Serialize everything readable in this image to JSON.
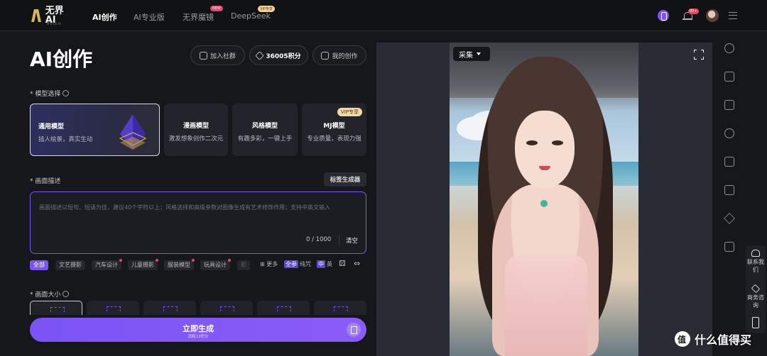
{
  "header": {
    "logo_text": "无界AI",
    "logo_sub": "MUSEAI",
    "nav": [
      {
        "label": "AI创作",
        "active": true
      },
      {
        "label": "AI专业版",
        "active": false
      },
      {
        "label": "无界魔镜",
        "badge": "NEW"
      },
      {
        "label": "DeepSeek",
        "badge": "VIP专享"
      }
    ],
    "notification_count": "99+"
  },
  "page": {
    "title": "AI创作",
    "join_community": "加入社群",
    "points": "36005积分",
    "my_creations": "我的创作"
  },
  "model_select": {
    "label": "* 模型选择",
    "cards": [
      {
        "name": "通用模型",
        "desc": "插人绘景，真实生动",
        "active": true
      },
      {
        "name": "漫画模型",
        "desc": "激发想象创作二次元"
      },
      {
        "name": "风格模型",
        "desc": "有趣多彩，一键上手"
      },
      {
        "name": "MJ模型",
        "desc": "专业质量，表现力强",
        "tag": "VIP专享"
      }
    ]
  },
  "prompt": {
    "label": "* 画面描述",
    "tag_generator": "标签生成器",
    "placeholder": "画面描述以短句、短语为佳，建议40个字符以上；风格选择和高级参数对图像生成有艺术修饰作用；支持中英文输入",
    "counter": "0 / 1000",
    "clear": "清空"
  },
  "tags": {
    "chips": [
      "全部",
      "文艺摄影",
      "汽车设计",
      "儿童摄影",
      "服装模型",
      "玩具设计",
      "影"
    ],
    "more": "更多",
    "pure_text_box": "全参",
    "pure_text": "纯咒",
    "lang_box": "中",
    "lang": "英"
  },
  "size": {
    "label": "* 画面大小"
  },
  "generate": {
    "label": "立即生成",
    "sub": "消耗12积分"
  },
  "preview": {
    "collect_label": "采集"
  },
  "float_panel": {
    "contact": "联系我们",
    "business": "商务咨询"
  },
  "watermark": {
    "text": "什么值得买"
  },
  "colors": {
    "accent": "#7b54f5",
    "background": "#16171b",
    "badge_red": "#e84368",
    "vip_gold": "#f3d9a8"
  }
}
